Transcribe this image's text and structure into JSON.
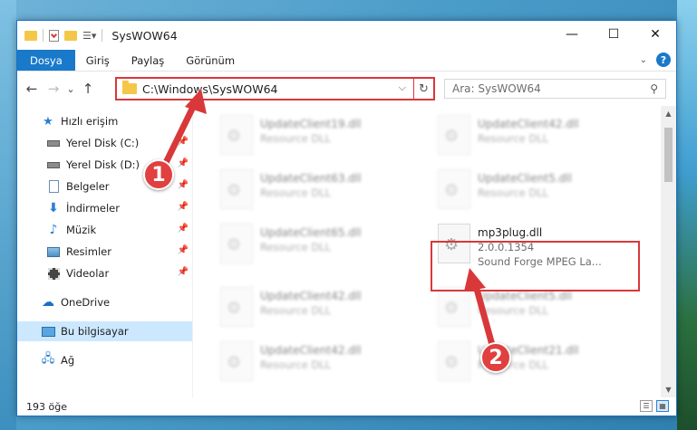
{
  "window": {
    "title": "SysWOW64",
    "controls": {
      "minimize": "—",
      "maximize": "☐",
      "close": "✕"
    }
  },
  "ribbon": {
    "tabs": [
      {
        "label": "Dosya",
        "active": true
      },
      {
        "label": "Giriş"
      },
      {
        "label": "Paylaş"
      },
      {
        "label": "Görünüm"
      }
    ],
    "help": "?"
  },
  "nav": {
    "back": "←",
    "forward": "→",
    "recent": "⌄",
    "up": "↑",
    "address": "C:\\Windows\\SysWOW64",
    "search_placeholder": "Ara: SysWOW64"
  },
  "sidebar": {
    "items": [
      {
        "label": "Hızlı erişim",
        "icon": "star-icon",
        "color": "#2a7fd4"
      },
      {
        "label": "Yerel Disk (C:)",
        "icon": "drive-icon",
        "pinned": true
      },
      {
        "label": "Yerel Disk (D:)",
        "icon": "drive-icon",
        "pinned": true
      },
      {
        "label": "Belgeler",
        "icon": "document-icon",
        "pinned": true
      },
      {
        "label": "İndirmeler",
        "icon": "download-icon",
        "pinned": true
      },
      {
        "label": "Müzik",
        "icon": "music-icon",
        "pinned": true
      },
      {
        "label": "Resimler",
        "icon": "pictures-icon",
        "pinned": true
      },
      {
        "label": "Videolar",
        "icon": "video-icon",
        "pinned": true
      },
      {
        "label": "OneDrive",
        "icon": "cloud-icon"
      },
      {
        "label": "Bu bilgisayar",
        "icon": "computer-icon",
        "selected": true
      },
      {
        "label": "Ağ",
        "icon": "network-icon"
      }
    ]
  },
  "files": [
    {
      "name": "UpdateClient19.dll",
      "type": "Resource DLL",
      "blurred": true
    },
    {
      "name": "UpdateClient42.dll",
      "type": "Resource DLL",
      "blurred": true
    },
    {
      "name": "UpdateClient63.dll",
      "type": "Resource DLL",
      "blurred": true
    },
    {
      "name": "UpdateClient5.dll",
      "type": "Resource DLL",
      "blurred": true
    },
    {
      "name": "UpdateClient65.dll",
      "type": "Resource DLL",
      "blurred": true
    },
    {
      "name": "mp3plug.dll",
      "version": "2.0.0.1354",
      "description": "Sound Forge MPEG La...",
      "blurred": false
    },
    {
      "name": "UpdateClient42.dll",
      "type": "Resource DLL",
      "blurred": true
    },
    {
      "name": "UpdateClient5.dll",
      "type": "Resource DLL",
      "blurred": true
    },
    {
      "name": "UpdateClient42.dll",
      "type": "Resource DLL",
      "blurred": true
    },
    {
      "name": "UpdateClient21.dll",
      "type": "Resource DLL",
      "blurred": true
    }
  ],
  "status": {
    "count": "193 öğe"
  },
  "annotations": {
    "callout1": "1",
    "callout2": "2",
    "color": "#d9383a"
  }
}
